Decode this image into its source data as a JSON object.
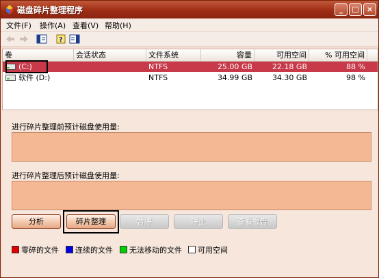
{
  "window": {
    "title": "磁盘碎片整理程序"
  },
  "title_buttons": {
    "minimize": "_",
    "maximize": "□",
    "close": "×"
  },
  "menu": [
    "文件(F)",
    "操作(A)",
    "查看(V)",
    "帮助(H)"
  ],
  "toolbar": {
    "icons": [
      "back-arrow-icon",
      "forward-arrow-icon",
      "properties-view-icon",
      "help-icon",
      "console-view-icon"
    ]
  },
  "volume_list": {
    "columns": [
      "卷",
      "会话状态",
      "文件系统",
      "容量",
      "可用空间",
      "% 可用空间"
    ],
    "rows": [
      {
        "volume": "(C:)",
        "session": "",
        "fs": "NTFS",
        "capacity": "25.00 GB",
        "free": "22.18 GB",
        "pct": "88 %",
        "selected": true
      },
      {
        "volume": "软件 (D:)",
        "session": "",
        "fs": "NTFS",
        "capacity": "34.99 GB",
        "free": "34.30 GB",
        "pct": "98 %",
        "selected": false
      }
    ]
  },
  "panes": {
    "before_label": "进行碎片整理前预计磁盘使用量:",
    "after_label": "进行碎片整理后预计磁盘使用量:"
  },
  "buttons": {
    "analyze": "分析",
    "defragment": "碎片整理",
    "pause": "暂停",
    "stop": "停止",
    "report": "查看报告"
  },
  "legend": [
    {
      "label": "零碎的文件",
      "color": "#e00000"
    },
    {
      "label": "连续的文件",
      "color": "#0000e0"
    },
    {
      "label": "无法移动的文件",
      "color": "#00d000"
    },
    {
      "label": "可用空间",
      "color": "#ffffff"
    }
  ],
  "colors": {
    "titlebar": "#9e2d14",
    "selection": "#c83a4a",
    "usage_bar": "#f4b894"
  }
}
